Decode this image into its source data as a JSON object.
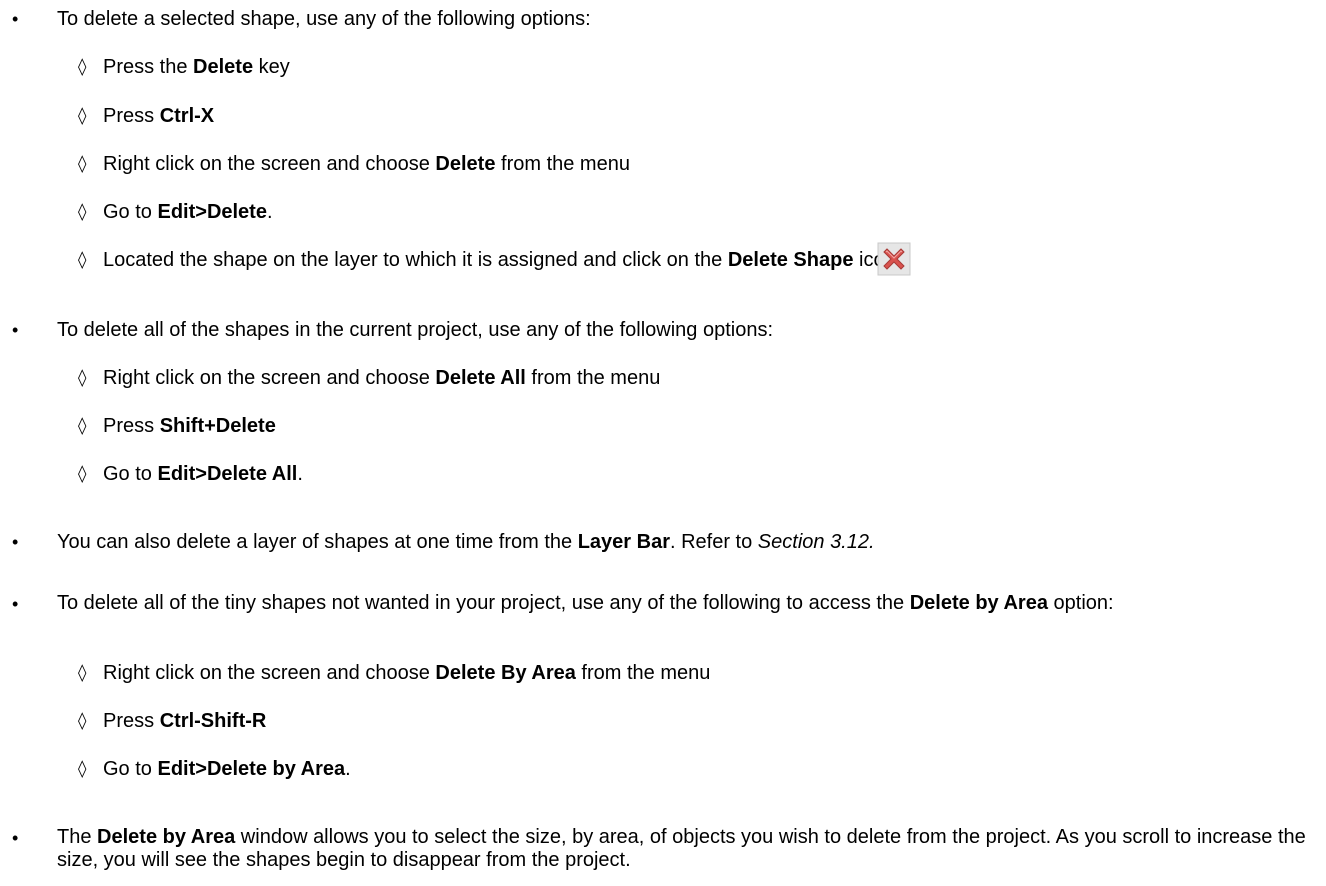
{
  "bullets": {
    "b1": {
      "text": "To delete a selected shape, use any of the following options:"
    },
    "b1_subs": {
      "s1": {
        "pre": "Press the ",
        "bold": "Delete",
        "post": " key"
      },
      "s2": {
        "pre": "Press ",
        "bold": "Ctrl-X"
      },
      "s3": {
        "pre": "Right click on the screen and choose ",
        "bold": "Delete",
        "post": " from the menu"
      },
      "s4": {
        "pre": "Go to ",
        "bold": "Edit>Delete",
        "post": "."
      },
      "s5": {
        "pre": "Located the shape on the layer to which it is assigned and click on the ",
        "bold": "Delete Shape",
        "post": " icon:",
        "icon": "delete-shape-x-icon"
      }
    },
    "b2": {
      "text": "To delete all of the shapes in the current project, use any of the following options:"
    },
    "b2_subs": {
      "s1": {
        "pre": "Right click on the screen and choose ",
        "bold": "Delete All",
        "post": " from the menu"
      },
      "s2": {
        "pre": "Press ",
        "bold": "Shift+Delete"
      },
      "s3": {
        "pre": "Go to ",
        "bold": "Edit>Delete All",
        "post": "."
      }
    },
    "b3": {
      "pre": "You can also delete a layer of shapes at one time from the ",
      "bold": "Layer Bar",
      "mid": ". Refer to ",
      "italic": "Section 3.12."
    },
    "b4": {
      "pre": "To delete all of the tiny shapes not wanted in your project, use any of the following to access the ",
      "bold": "Delete by Area",
      "post": " option:"
    },
    "b4_subs": {
      "s1": {
        "pre": "Right click on the screen and choose ",
        "bold": "Delete By Area",
        "post": " from the menu"
      },
      "s2": {
        "pre": "Press ",
        "bold": "Ctrl-Shift-R"
      },
      "s3": {
        "pre": "Go to ",
        "bold": "Edit>Delete by Area",
        "post": "."
      }
    },
    "b5": {
      "pre": "The ",
      "bold": "Delete by Area",
      "post": " window allows you to select the size, by area, of objects you wish to delete from the project. As you scroll to increase the size, you will see the shapes begin to disappear from the project."
    }
  },
  "symbols": {
    "bullet": "•",
    "diamond": "◊"
  },
  "colors": {
    "icon_red": "#d9534f",
    "icon_bg": "#e6e6e6"
  }
}
